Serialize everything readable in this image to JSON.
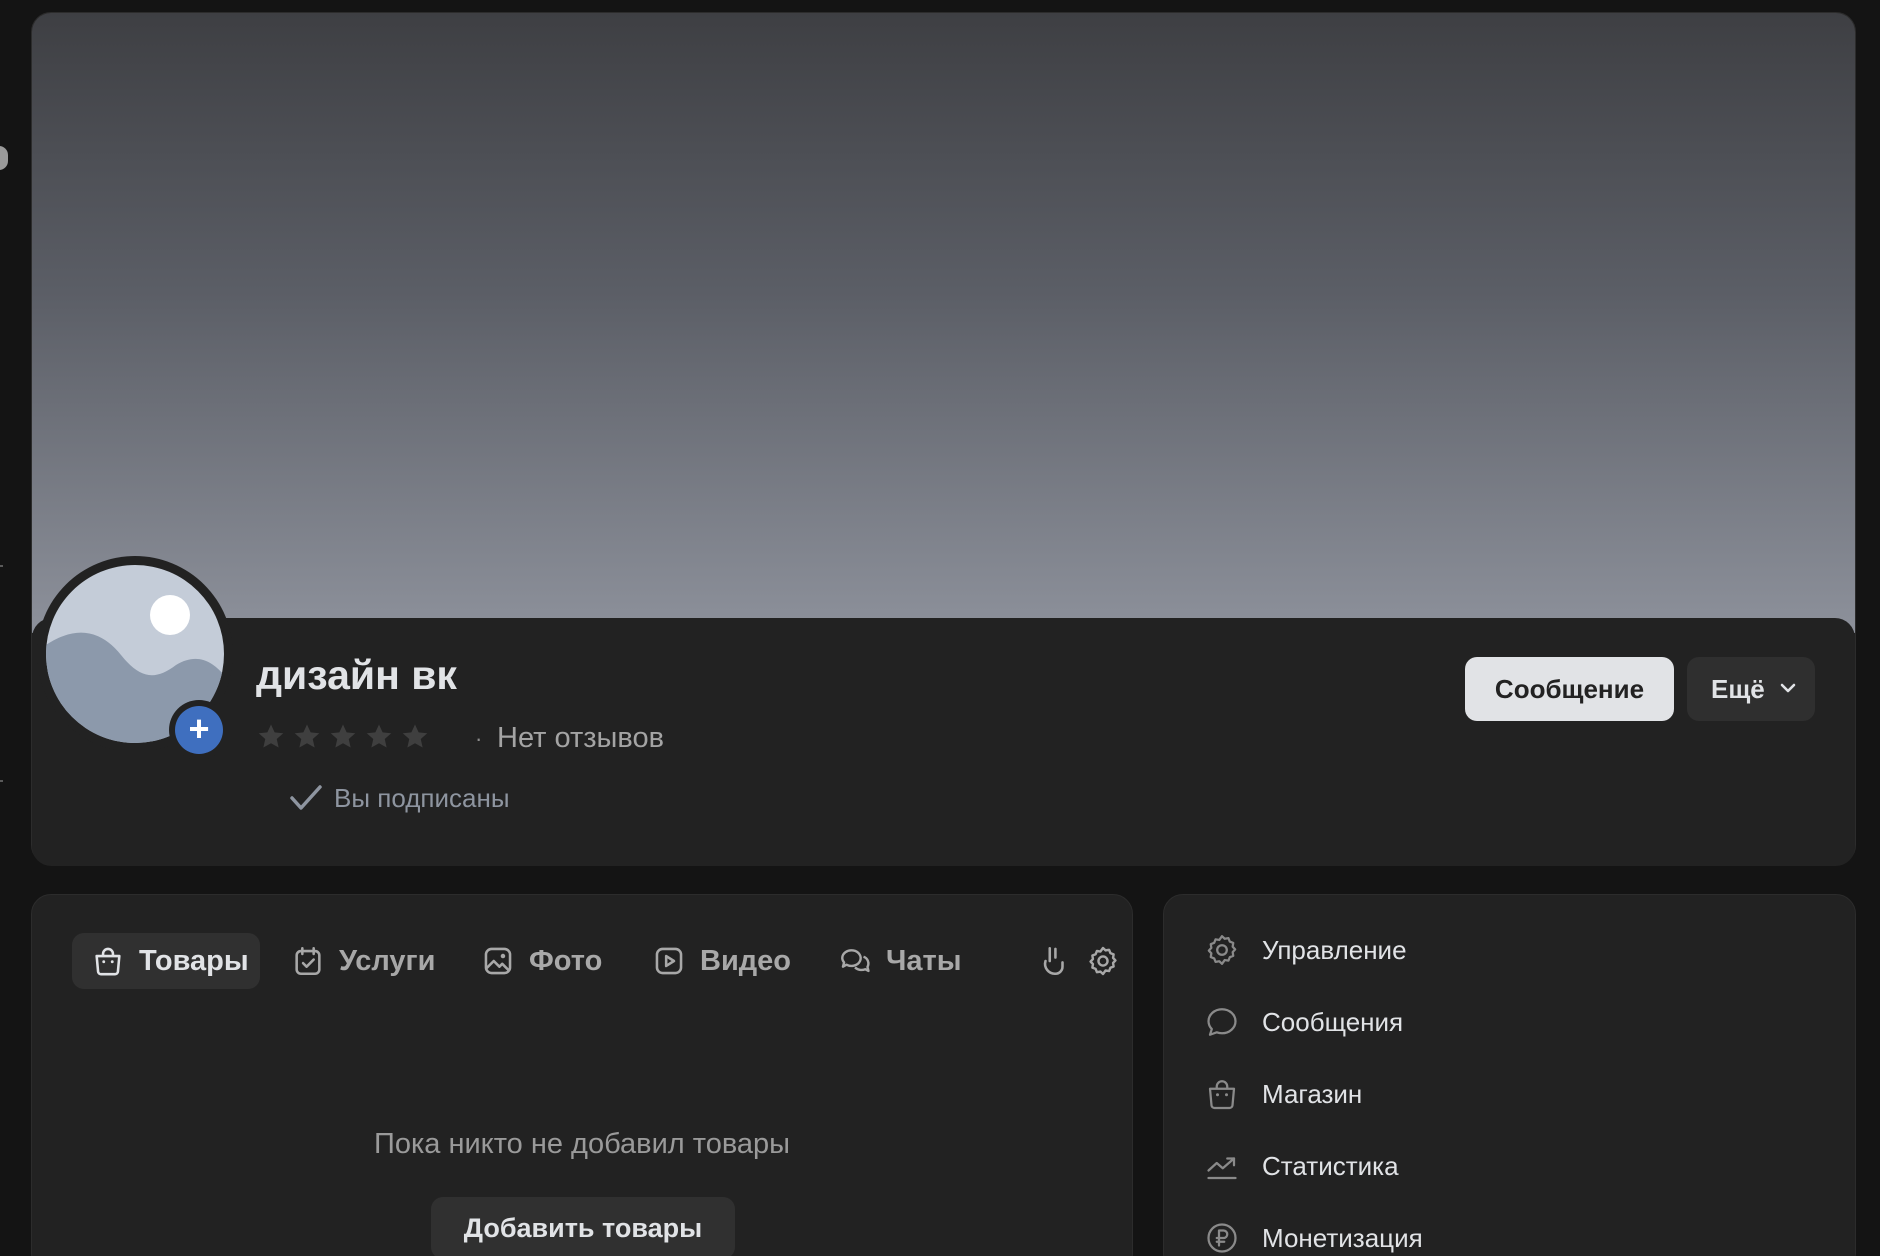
{
  "community": {
    "name": "дизайн вк",
    "rating_stars": 5,
    "rating_separator": "·",
    "reviews_text": "Нет отзывов",
    "subscribed_text": "Вы подписаны"
  },
  "actions": {
    "message_label": "Сообщение",
    "more_label": "Ещё"
  },
  "tabs": [
    {
      "label": "Товары",
      "icon": "bag-icon",
      "active": true
    },
    {
      "label": "Услуги",
      "icon": "calendar-check-icon",
      "active": false
    },
    {
      "label": "Фото",
      "icon": "image-icon",
      "active": false
    },
    {
      "label": "Видео",
      "icon": "play-icon",
      "active": false
    },
    {
      "label": "Чаты",
      "icon": "chats-icon",
      "active": false
    },
    {
      "label": "",
      "icon": "gesture-hand-icon",
      "active": false
    },
    {
      "label": "",
      "icon": "gear-icon",
      "active": false
    }
  ],
  "main": {
    "empty_text": "Пока никто не добавил товары",
    "add_button_label": "Добавить товары"
  },
  "menu": {
    "items": [
      {
        "label": "Управление",
        "icon": "gear-icon"
      },
      {
        "label": "Сообщения",
        "icon": "message-bubble-icon"
      },
      {
        "label": "Магазин",
        "icon": "bag-icon"
      },
      {
        "label": "Статистика",
        "icon": "trend-chart-icon"
      },
      {
        "label": "Монетизация",
        "icon": "ruble-coin-icon"
      }
    ]
  },
  "colors": {
    "background": "#141414",
    "card": "#222222",
    "accent_blue": "#3f6fbf",
    "primary_button": "#e1e3e6",
    "muted_text": "#a4a4a4"
  }
}
